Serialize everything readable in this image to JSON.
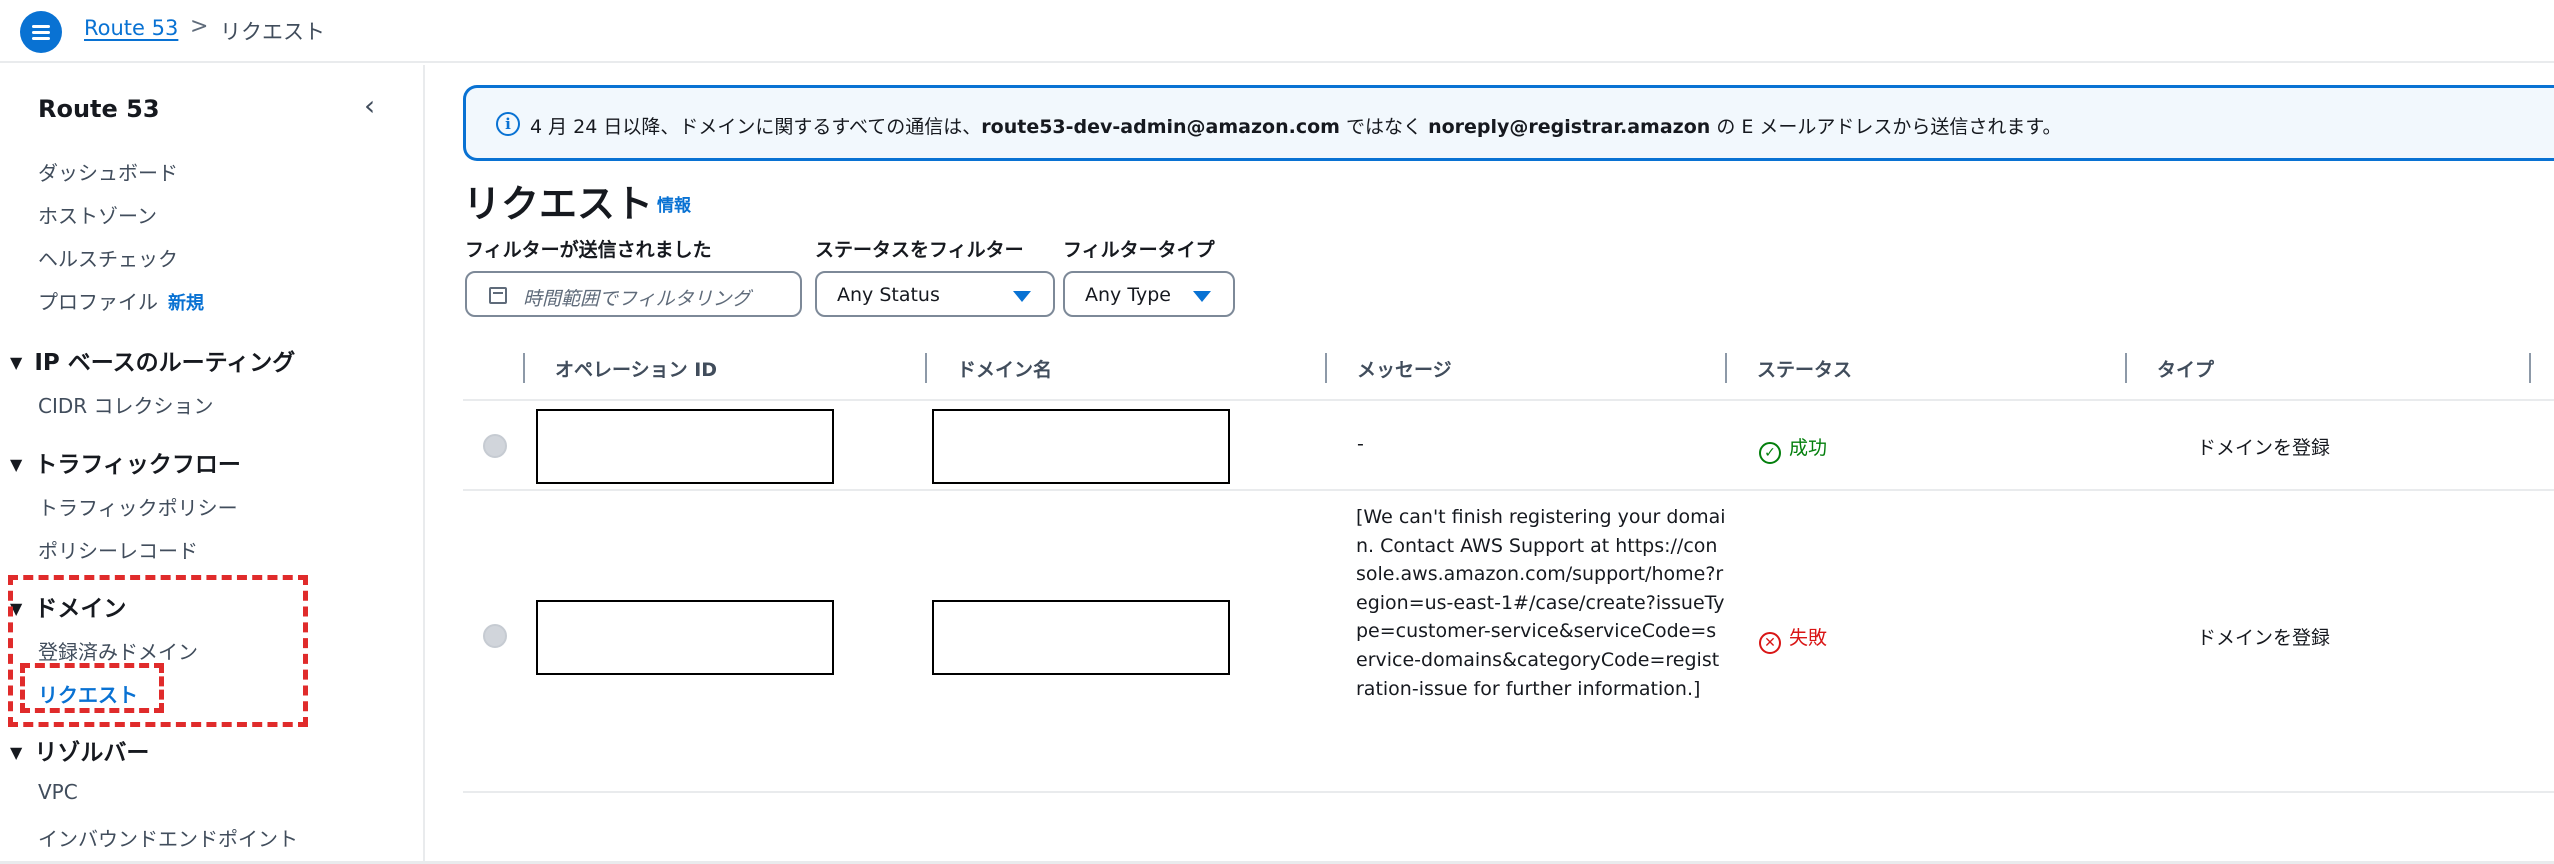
{
  "breadcrumb": {
    "service": "Route 53",
    "separator": ">",
    "current": "リクエスト"
  },
  "sidebar": {
    "title": "Route 53",
    "items": [
      {
        "label": "ダッシュボード"
      },
      {
        "label": "ホストゾーン"
      },
      {
        "label": "ヘルスチェック"
      },
      {
        "label": "プロファイル",
        "badge": "新規"
      }
    ],
    "sections": [
      {
        "title": "IP ベースのルーティング",
        "items": [
          "CIDR コレクション"
        ]
      },
      {
        "title": "トラフィックフロー",
        "items": [
          "トラフィックポリシー",
          "ポリシーレコード"
        ]
      },
      {
        "title": "ドメイン",
        "items": [
          "登録済みドメイン",
          "リクエスト"
        ]
      },
      {
        "title": "リゾルバー",
        "items": [
          "VPC",
          "インバウンドエンドポイント"
        ]
      }
    ]
  },
  "flash": {
    "prefix": "4 月 24 日以降、ドメインに関するすべての通信は、",
    "from_email": "route53-dev-admin@amazon.com",
    "middle": " ではなく ",
    "to_email": "noreply@registrar.amazon",
    "suffix": " の E メールアドレスから送信されます。"
  },
  "page": {
    "title": "リクエスト",
    "info_link": "情報"
  },
  "filters": {
    "submitted_label": "フィルターが送信されました",
    "submitted_placeholder": "時間範囲でフィルタリング",
    "status_label": "ステータスをフィルター",
    "status_value": "Any Status",
    "type_label": "フィルタータイプ",
    "type_value": "Any Type"
  },
  "table": {
    "columns": [
      "オペレーション ID",
      "ドメイン名",
      "メッセージ",
      "ステータス",
      "タイプ"
    ],
    "rows": [
      {
        "operation_id": "",
        "domain": "",
        "message": "-",
        "status": "成功",
        "status_kind": "success",
        "type": "ドメインを登録"
      },
      {
        "operation_id": "",
        "domain": "",
        "message": "[We can't finish registering your domain. Contact AWS Support at https://console.aws.amazon.com/support/home?region=us-east-1#/case/create?issueType=customer-service&serviceCode=service-domains&categoryCode=registration-issue for further information.]",
        "status": "失敗",
        "status_kind": "error",
        "type": "ドメインを登録"
      }
    ]
  },
  "colors": {
    "accent": "#0972d3",
    "success": "#037f0c",
    "error": "#d91515",
    "highlight": "#e02b2b"
  },
  "icons": {
    "menu": "menu-icon",
    "info": "info-icon",
    "calendar": "calendar-icon",
    "success": "check-circle-icon",
    "error": "x-circle-icon"
  }
}
